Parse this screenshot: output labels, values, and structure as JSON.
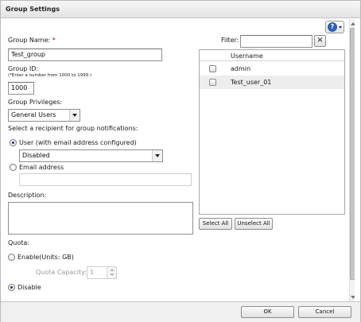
{
  "dialog": {
    "title": "Group Settings"
  },
  "help": {
    "icon": "help-icon",
    "glyph": "?"
  },
  "form": {
    "group_name": {
      "label": "Group Name:",
      "required_mark": "*",
      "value": "Test_group"
    },
    "group_id": {
      "label": "Group ID:",
      "hint": "(*Enter a number from 1000 to 1999.)",
      "value": "1000"
    },
    "group_privileges": {
      "label": "Group Privileges:",
      "value": "General Users"
    },
    "notifications": {
      "label": "Select a recipient for group notifications:",
      "option_user": "User (with email address configured)",
      "user_select_value": "Disabled",
      "option_email": "Email address",
      "email_value": "",
      "selected": "user"
    },
    "description": {
      "label": "Description:",
      "value": ""
    },
    "quota": {
      "label": "Quota:",
      "option_enable": "Enable(Units: GB)",
      "capacity_label": "Quota Capacity:",
      "capacity_value": "1",
      "option_disable": "Disable",
      "selected": "disable"
    }
  },
  "members": {
    "filter_label": "Filter:",
    "filter_value": "",
    "clear_glyph": "×",
    "column_header": "Username",
    "users": [
      "admin",
      "Test_user_01"
    ],
    "select_all": "Select All",
    "unselect_all": "Unselect All"
  },
  "footer": {
    "ok": "OK",
    "cancel": "Cancel"
  }
}
